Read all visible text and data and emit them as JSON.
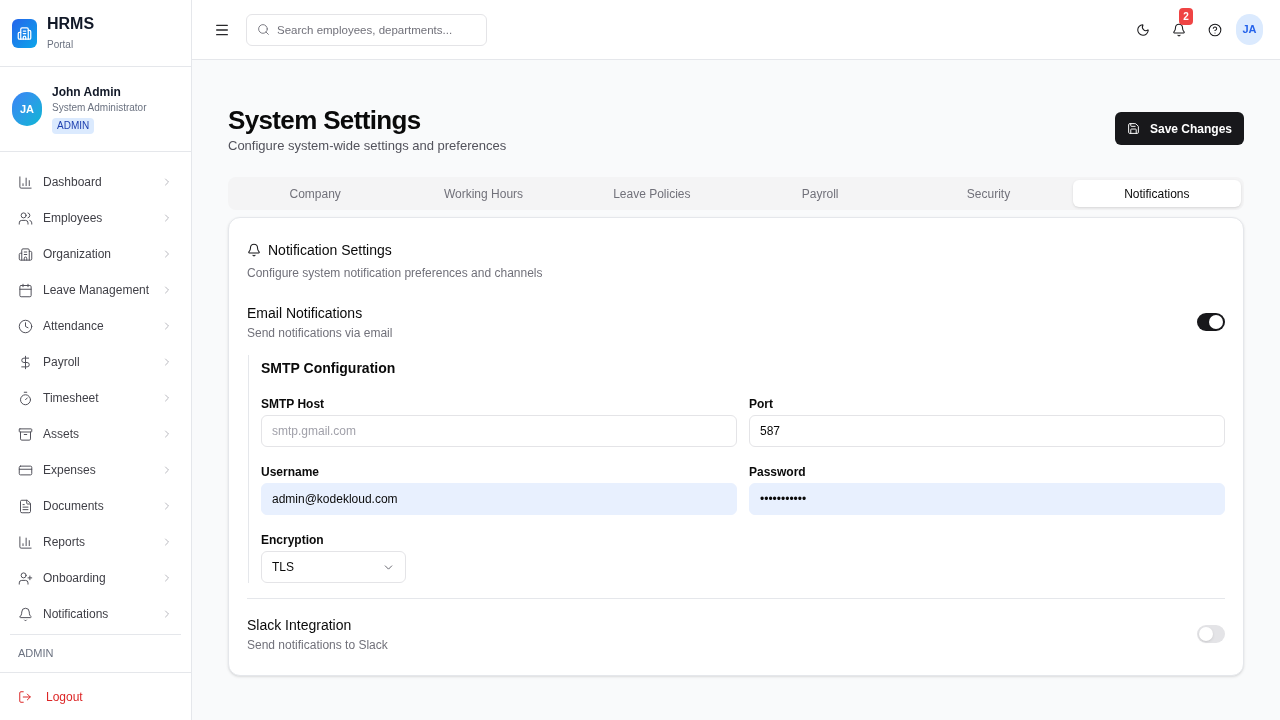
{
  "sidebar": {
    "brand": {
      "name": "HRMS",
      "tagline": "Portal"
    },
    "user": {
      "initials": "JA",
      "name": "John Admin",
      "role": "System Administrator",
      "badge": "ADMIN"
    },
    "nav_items": [
      {
        "label": "Dashboard",
        "selected": false
      },
      {
        "label": "Employees",
        "selected": false
      },
      {
        "label": "Organization",
        "selected": false
      },
      {
        "label": "Leave Management",
        "selected": false
      },
      {
        "label": "Attendance",
        "selected": false
      },
      {
        "label": "Payroll",
        "selected": false
      },
      {
        "label": "Timesheet",
        "selected": false
      },
      {
        "label": "Assets",
        "selected": false
      },
      {
        "label": "Expenses",
        "selected": false
      },
      {
        "label": "Documents",
        "selected": false
      },
      {
        "label": "Reports",
        "selected": false
      },
      {
        "label": "Onboarding",
        "selected": false
      },
      {
        "label": "Notifications",
        "selected": false
      }
    ],
    "section_label": "ADMIN",
    "logout": "Logout"
  },
  "header": {
    "search": {
      "placeholder": "Search employees, departments..."
    },
    "notification_count": "2",
    "avatar": "JA"
  },
  "page": {
    "title": "System Settings",
    "subtitle": "Configure system-wide settings and preferences",
    "save_button": "Save Changes"
  },
  "tabs": [
    {
      "label": "Company",
      "selected": false
    },
    {
      "label": "Working Hours",
      "selected": false
    },
    {
      "label": "Leave Policies",
      "selected": false
    },
    {
      "label": "Payroll",
      "selected": false
    },
    {
      "label": "Security",
      "selected": false
    },
    {
      "label": "Notifications",
      "selected": true
    }
  ],
  "notification_settings": {
    "title": "Notification Settings",
    "description": "Configure system notification preferences and channels",
    "email_notifications": {
      "title": "Email Notifications",
      "description": "Send notifications via email",
      "on": true
    },
    "smtp": {
      "title": "SMTP Configuration",
      "fields": [
        {
          "kind": "text",
          "label": "SMTP Host",
          "placeholder": "smtp.gmail.com",
          "autofilled": false
        },
        {
          "kind": "text",
          "label": "Port",
          "value": "587",
          "autofilled": false
        },
        {
          "kind": "text",
          "label": "Username",
          "value": "admin@kodekloud.com",
          "autofilled": true
        },
        {
          "kind": "text",
          "label": "Password",
          "value": "•••••••••••",
          "autofilled": true
        },
        {
          "kind": "select",
          "label": "Encryption",
          "value": "TLS"
        }
      ]
    },
    "slack_integration": {
      "title": "Slack Integration",
      "description": "Send notifications to Slack",
      "on": false
    }
  }
}
